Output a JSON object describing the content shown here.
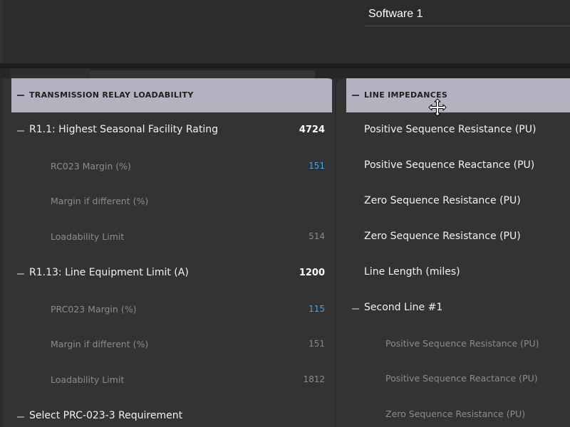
{
  "topbar": {
    "software_label": "Software 1"
  },
  "left_panel": {
    "header": "TRANSMISSION RELAY LOADABILITY",
    "rows": [
      {
        "label": "R1.1: Highest Seasonal Facility Rating",
        "value": "4724"
      },
      {
        "label": "RC023 Margin (%)",
        "value": "151",
        "value_color": "#4aa3e6"
      },
      {
        "label": "Margin if different (%)",
        "value": ""
      },
      {
        "label": "Loadability Limit",
        "value": "514"
      },
      {
        "label": "R1.13: Line Equipment Limit (A)",
        "value": "1200"
      },
      {
        "label": "PRC023 Margin (%)",
        "value": "115",
        "value_color": "#4aa3e6"
      },
      {
        "label": "Margin if different (%)",
        "value": "151"
      },
      {
        "label": "Loadability Limit",
        "value": "1812"
      },
      {
        "label": "Select PRC-023-3 Requirement",
        "value": ""
      }
    ]
  },
  "right_panel": {
    "header": "LINE IMPEDANCES",
    "rows": [
      {
        "label": "Positive Sequence Resistance (PU)"
      },
      {
        "label": "Positive Sequence Reactance (PU)"
      },
      {
        "label": "Zero Sequence Resistance (PU)"
      },
      {
        "label": "Zero Sequence Resistance (PU)"
      },
      {
        "label": "Line Length (miles)"
      },
      {
        "label": "Second Line #1"
      },
      {
        "label": "Positive Sequence Resistance (PU)"
      },
      {
        "label": "Positive Sequence Reactance (PU)"
      },
      {
        "label": "Zero Sequence Resistance (PU)"
      }
    ]
  },
  "cursor": {
    "icon": "move-cursor-icon"
  }
}
